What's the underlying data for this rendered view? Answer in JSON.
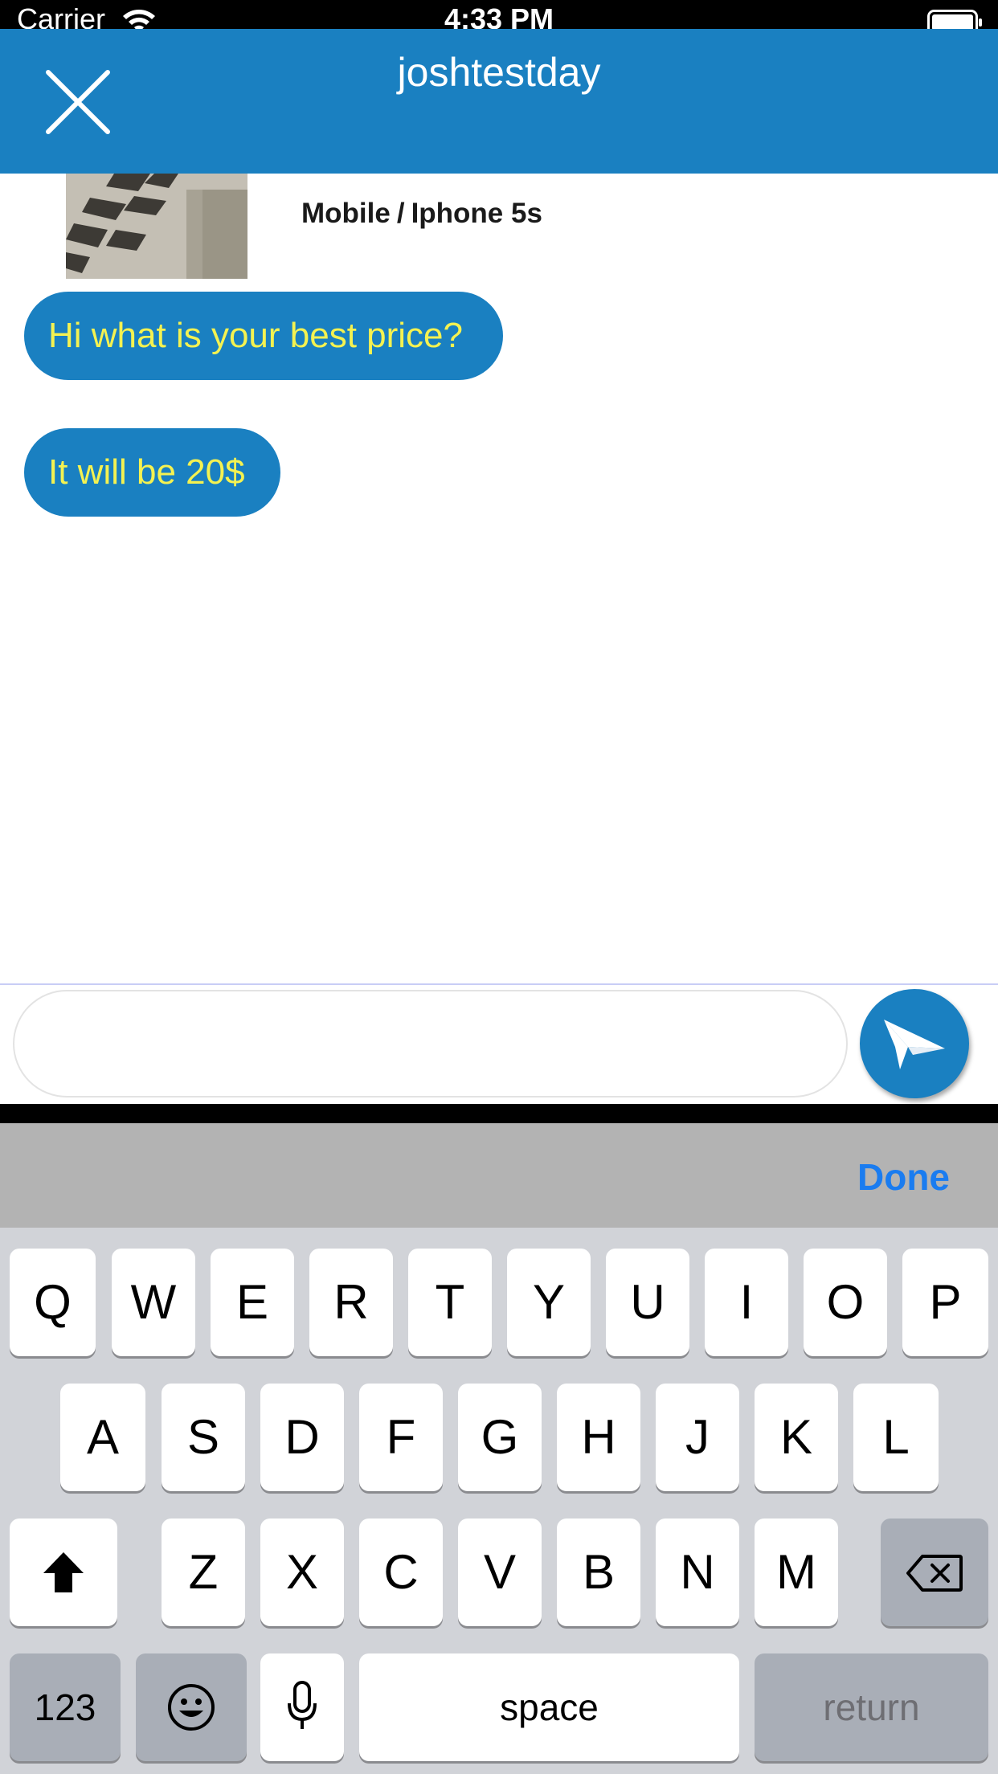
{
  "status_bar": {
    "carrier": "Carrier",
    "time": "4:33 PM"
  },
  "nav": {
    "title": "joshtestday",
    "close_icon": "close-icon"
  },
  "product": {
    "category": "Mobile",
    "separator": "/",
    "name": "Iphone 5s"
  },
  "messages": [
    {
      "text": "Hi what is your best price?"
    },
    {
      "text": "It will be 20$"
    }
  ],
  "composer": {
    "value": "",
    "placeholder": "",
    "send_icon": "paper-plane-icon"
  },
  "toolbar": {
    "done_label": "Done"
  },
  "keyboard": {
    "row1": [
      "Q",
      "W",
      "E",
      "R",
      "T",
      "Y",
      "U",
      "I",
      "O",
      "P"
    ],
    "row2": [
      "A",
      "S",
      "D",
      "F",
      "G",
      "H",
      "J",
      "K",
      "L"
    ],
    "row3": [
      "Z",
      "X",
      "C",
      "V",
      "B",
      "N",
      "M"
    ],
    "numbers_label": "123",
    "space_label": "space",
    "return_label": "return",
    "shift_icon": "shift-icon",
    "delete_icon": "backspace-icon",
    "emoji_icon": "emoji-icon",
    "mic_icon": "microphone-icon"
  },
  "colors": {
    "brand": "#1a80c1",
    "bubble_text": "#f4f251",
    "done": "#1a7cf0"
  }
}
